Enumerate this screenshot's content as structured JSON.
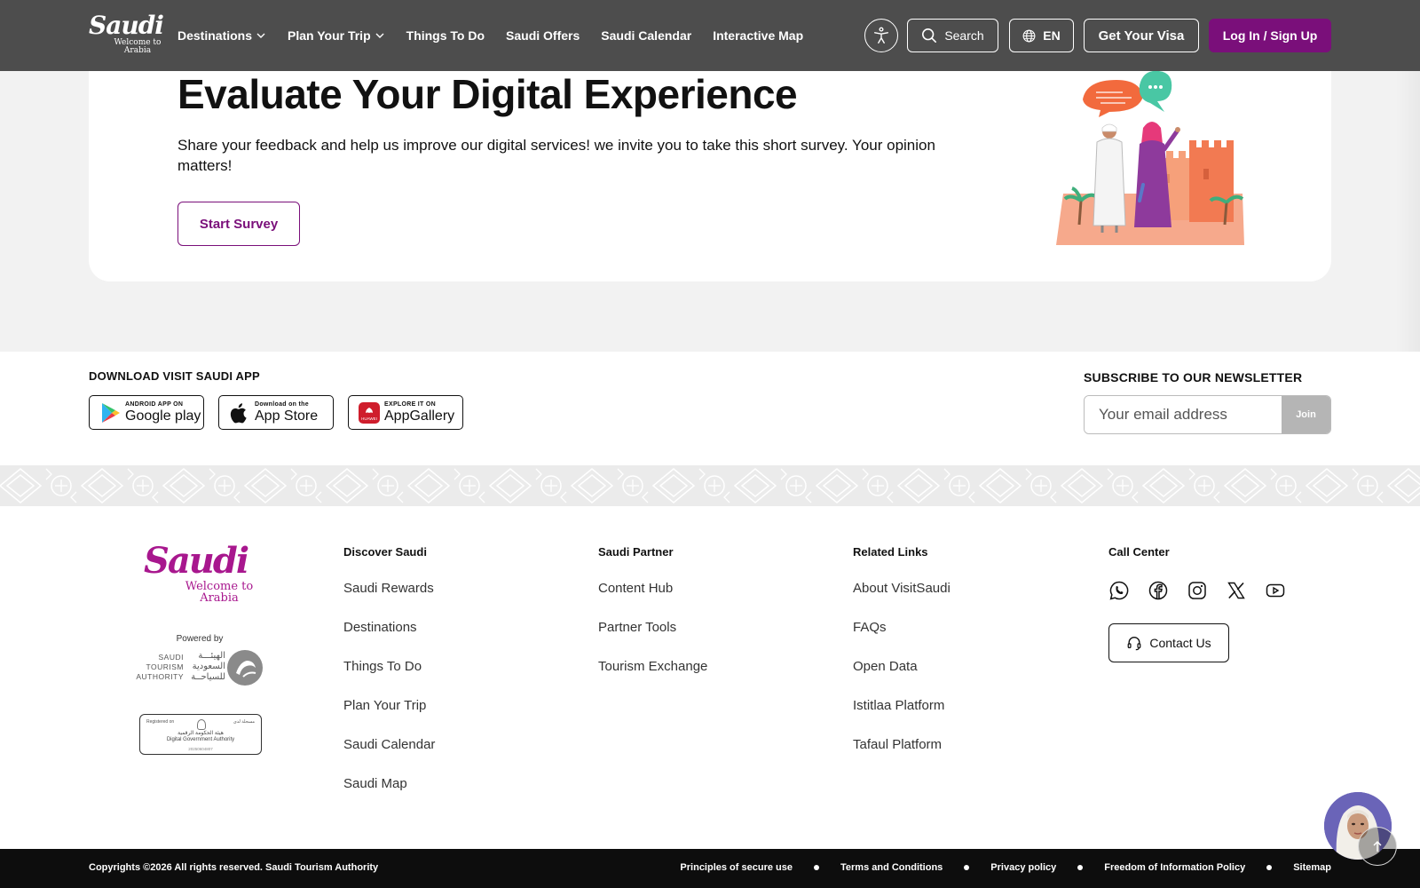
{
  "header": {
    "logo": {
      "brand": "Saudi",
      "tagline": "Welcome to Arabia"
    },
    "nav": [
      {
        "label": "Destinations",
        "has_dropdown": true
      },
      {
        "label": "Plan Your Trip",
        "has_dropdown": true
      },
      {
        "label": "Things To Do",
        "has_dropdown": false
      },
      {
        "label": "Saudi Offers",
        "has_dropdown": false
      },
      {
        "label": "Saudi Calendar",
        "has_dropdown": false
      },
      {
        "label": "Interactive Map",
        "has_dropdown": false
      }
    ],
    "accessibility_icon": "accessibility-icon",
    "search_label": "Search",
    "language_label": "EN",
    "visa_label": "Get Your Visa",
    "login_label": "Log In / Sign Up"
  },
  "survey": {
    "title": "Evaluate Your Digital Experience",
    "description": "Share your feedback and help us improve our digital services! we invite you to take this short survey. Your opinion matters!",
    "button_label": "Start Survey"
  },
  "app_download": {
    "title": "DOWNLOAD VISIT SAUDI APP",
    "stores": [
      {
        "small": "ANDROID APP ON",
        "big": "Google play",
        "icon": "google-play-icon"
      },
      {
        "small": "Download on the",
        "big": "App Store",
        "icon": "apple-icon"
      },
      {
        "small": "EXPLORE IT ON",
        "big": "AppGallery",
        "icon": "huawei-icon"
      }
    ]
  },
  "newsletter": {
    "title": "SUBSCRIBE TO OUR NEWSLETTER",
    "placeholder": "Your email address",
    "join_label": "Join"
  },
  "footer": {
    "logo": {
      "brand": "Saudi",
      "tagline": "Welcome to Arabia"
    },
    "powered_by": "Powered by",
    "authority_en": [
      "SAUDI",
      "TOURISM",
      "AUTHORITY"
    ],
    "authority_ar": [
      "الهيئـــة",
      "السعودية",
      "للسياحــة"
    ],
    "dga": {
      "registered": "Registered on",
      "registered_ar": "مسجلة لدى",
      "name_ar": "هيئة الحكومة الرقمية",
      "name_en": "Digital Government Authority",
      "number": "20250604807"
    },
    "columns": [
      {
        "title": "Discover Saudi",
        "links": [
          "Saudi Rewards",
          "Destinations",
          "Things To Do",
          "Plan Your Trip",
          "Saudi Calendar",
          "Saudi Map"
        ]
      },
      {
        "title": "Saudi Partner",
        "links": [
          "Content Hub",
          "Partner Tools",
          "Tourism Exchange"
        ]
      },
      {
        "title": "Related Links",
        "links": [
          "About VisitSaudi",
          "FAQs",
          "Open Data",
          "Istitlaa Platform",
          "Tafaul Platform"
        ]
      }
    ],
    "call_center": {
      "title": "Call Center",
      "socials": [
        "whatsapp-icon",
        "facebook-icon",
        "instagram-icon",
        "x-icon",
        "youtube-icon"
      ],
      "contact_label": "Contact Us"
    }
  },
  "bottom_bar": {
    "copyright": "Copyrights ©2026 All rights reserved. Saudi Tourism Authority",
    "links": [
      "Principles of secure use",
      "Terms and Conditions",
      "Privacy policy",
      "Freedom of Information Policy",
      "Sitemap"
    ]
  },
  "colors": {
    "header_bg": "#4d4d4d",
    "brand_purple": "#7a0f7a",
    "logo_magenta": "#a8178e",
    "bottom_bar_bg": "#0d0d0d",
    "page_bg": "#f2f2f2"
  }
}
